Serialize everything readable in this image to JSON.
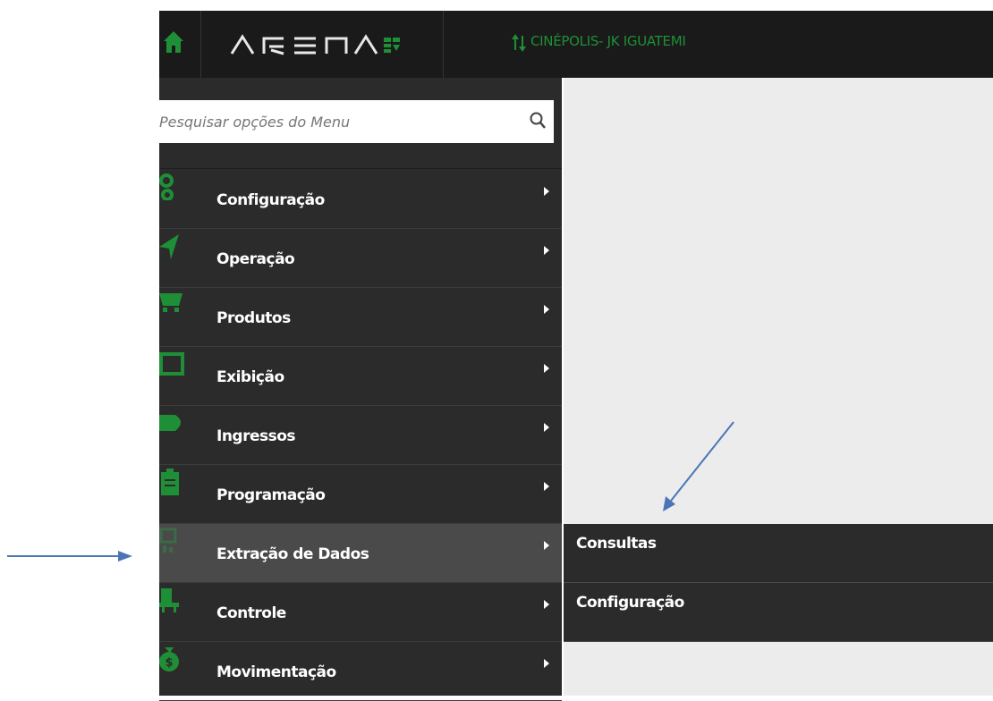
{
  "header": {
    "logo_text": "ARENA",
    "venue": "CINÉPOLIS- JK IGUATEMI"
  },
  "search": {
    "placeholder": "Pesquisar opções do Menu"
  },
  "menu": {
    "items": [
      {
        "label": "Configuração",
        "icon": "gears-icon"
      },
      {
        "label": "Operação",
        "icon": "navigation-arrow-icon"
      },
      {
        "label": "Produtos",
        "icon": "cart-icon"
      },
      {
        "label": "Exibição",
        "icon": "screen-icon"
      },
      {
        "label": "Ingressos",
        "icon": "ticket-icon"
      },
      {
        "label": "Programação",
        "icon": "clipboard-icon"
      },
      {
        "label": "Extração de Dados",
        "icon": "data-chart-icon",
        "active": true
      },
      {
        "label": "Controle",
        "icon": "chair-icon"
      },
      {
        "label": "Movimentação",
        "icon": "money-bag-icon"
      }
    ]
  },
  "submenu": {
    "items": [
      {
        "label": "Consultas"
      },
      {
        "label": "Configuração"
      }
    ]
  },
  "colors": {
    "topbar": "#1a1a1a",
    "sidebar": "#2b2b2b",
    "active_item": "#4a4a4a",
    "accent_green": "#1f8f37",
    "content_bg": "#ececec",
    "annotation_blue": "#4a76b8"
  }
}
